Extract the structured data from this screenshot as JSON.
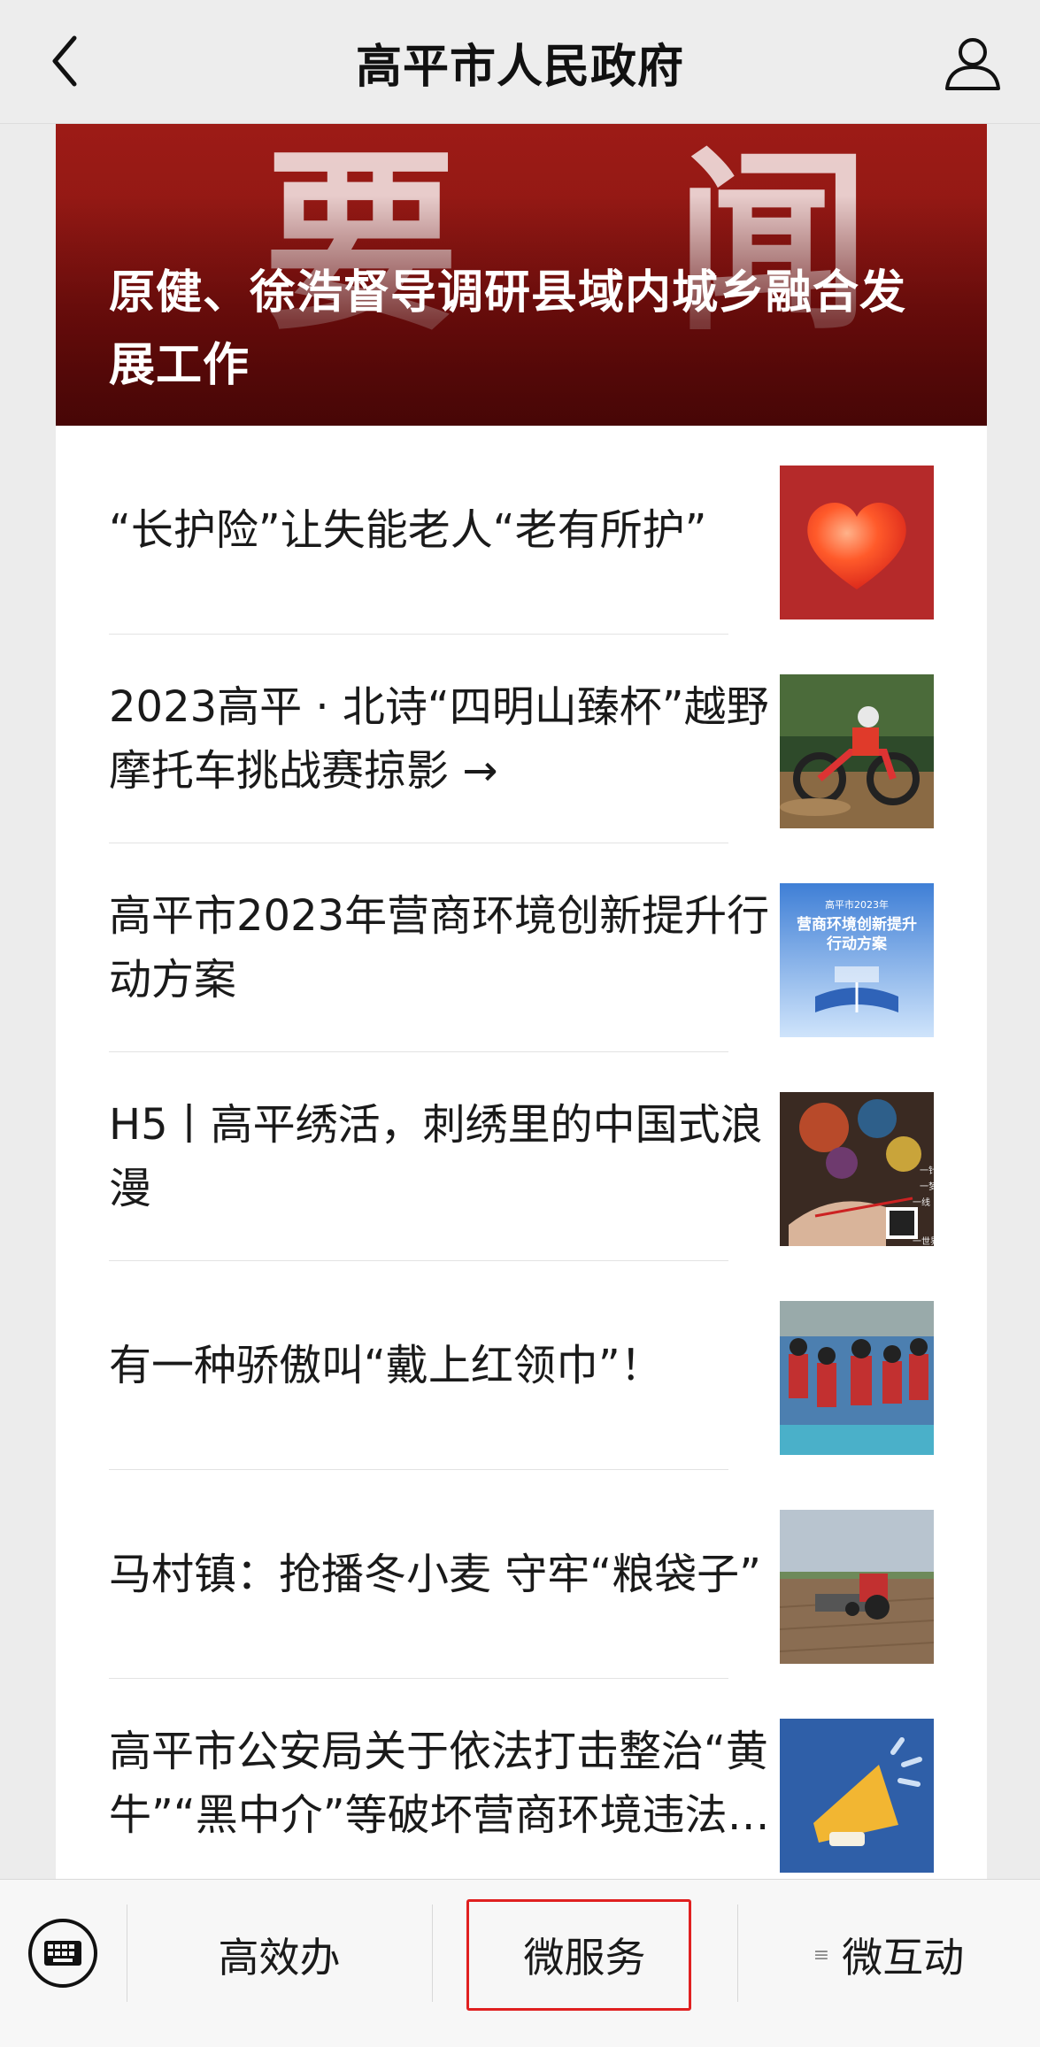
{
  "header": {
    "title": "高平市人民政府",
    "back_icon": "chevron-left-icon",
    "profile_icon": "user-icon"
  },
  "hero": {
    "bg_chars": [
      "要",
      "闻"
    ],
    "title": "原健、徐浩督导调研县域内城乡融合发展工作"
  },
  "news": [
    {
      "title": "“长护险”让失能老人“老有所护”",
      "thumb": "heart-image"
    },
    {
      "title": "2023高平 · 北诗“四明山臻杯”越野摩托车挑战赛掠影 →",
      "thumb": "motocross-image"
    },
    {
      "title": "高平市2023年营商环境创新提升行动方案",
      "thumb": "business-environment-poster"
    },
    {
      "title": "H5丨高平绣活，刺绣里的中国式浪漫",
      "thumb": "embroidery-image"
    },
    {
      "title": "有一种骄傲叫“戴上红领巾”！",
      "thumb": "students-image"
    },
    {
      "title": "马村镇：抢播冬小麦 守牢“粮袋子”",
      "thumb": "tractor-image"
    },
    {
      "title": "高平市公安局关于依法打击整治“黄牛”“黑中介”等破坏营商环境违法犯罪的通告",
      "thumb": "megaphone-image"
    }
  ],
  "thumb_text": {
    "poster_line1": "高平市2023年",
    "poster_line2": "营商环境创新提升",
    "poster_line3": "行动方案",
    "embroidery_a": "一针",
    "embroidery_b": "一梦境",
    "embroidery_c": "一线",
    "embroidery_d": "一世界"
  },
  "bottom_bar": {
    "keyboard_icon": "keyboard-icon",
    "menus": [
      {
        "label": "高效办",
        "mini": ""
      },
      {
        "label": "微服务",
        "mini": ""
      },
      {
        "label": "微互动",
        "mini": "≡"
      }
    ]
  },
  "colors": {
    "hero_red": "#9d1b16",
    "highlight_border": "#e02020",
    "header_bg": "#ededed"
  }
}
